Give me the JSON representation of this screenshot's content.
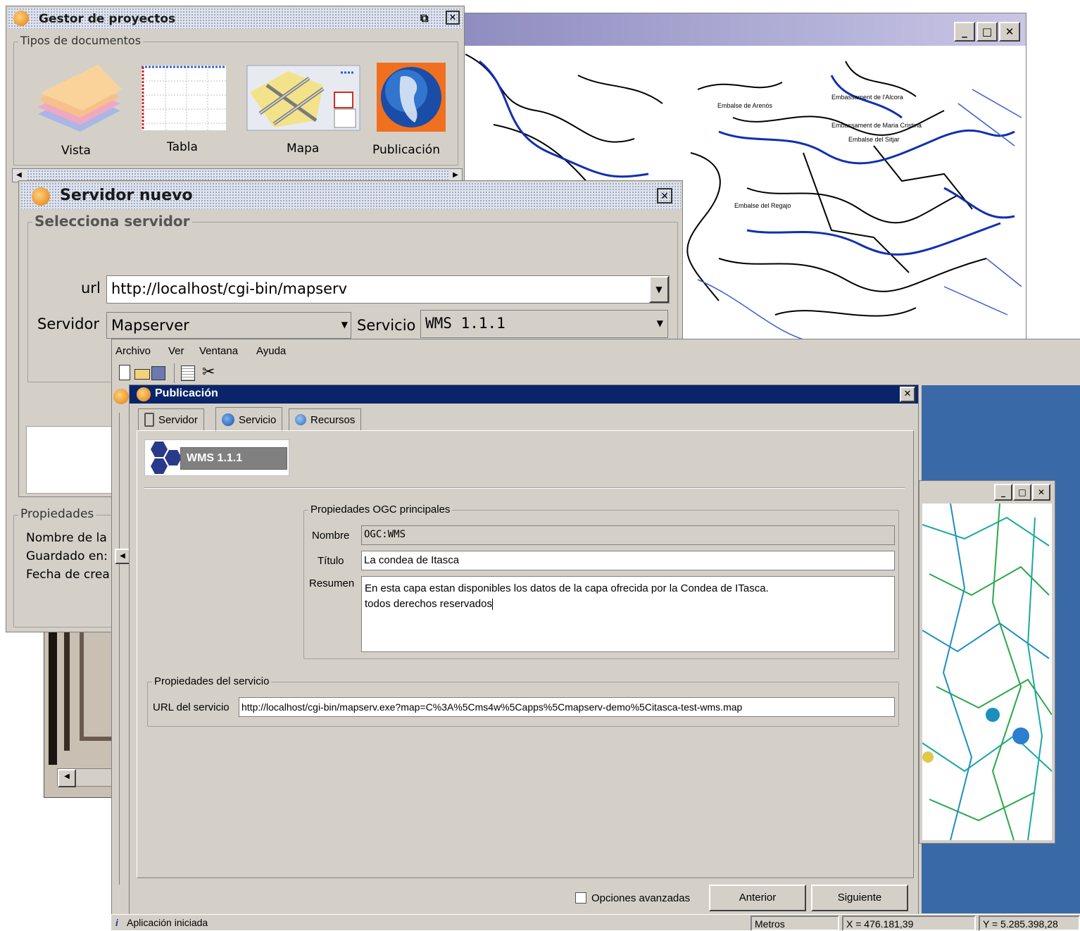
{
  "background_map_window": {
    "labels": [
      "Embalse de Arenós",
      "Embassament de l'Alcora",
      "Embassament de Maria Cristina",
      "Embalse del Sitjar",
      "Embalse del Regajo"
    ]
  },
  "project_manager": {
    "title": "Gestor de proyectos",
    "doc_types_label": "Tipos de documentos",
    "doc_types": [
      {
        "label": "Vista",
        "icon": "vista-layers-icon"
      },
      {
        "label": "Tabla",
        "icon": "table-icon"
      },
      {
        "label": "Mapa",
        "icon": "map-icon"
      },
      {
        "label": "Publicación",
        "icon": "globe-icon"
      }
    ],
    "properties_label": "Propiedades",
    "properties": [
      "Nombre de la",
      "Guardado en:",
      "Fecha de crea"
    ]
  },
  "new_server": {
    "title": "Servidor nuevo",
    "select_server_label": "Selecciona servidor",
    "url_label": "url",
    "url_value": "http://localhost/cgi-bin/mapserv",
    "server_label": "Servidor",
    "server_value": "Mapserver",
    "service_label": "Servicio",
    "service_value": "WMS 1.1.1"
  },
  "main_app": {
    "menu": [
      "Archivo",
      "Ver",
      "Ventana",
      "Ayuda"
    ],
    "status_text": "Aplicación iniciada",
    "units": "Metros",
    "x_coord": "X = 476.181,39",
    "y_coord": "Y = 5.285.398,28"
  },
  "publication": {
    "title": "Publicación",
    "tabs": [
      "Servidor",
      "Servicio",
      "Recursos"
    ],
    "badge": "WMS 1.1.1",
    "ogc_group": "Propiedades OGC principales",
    "name_label": "Nombre",
    "name_value": "OGC:WMS",
    "title_label": "Título",
    "title_value": "La condea de Itasca",
    "abstract_label": "Resumen",
    "abstract_line1": "En esta capa estan disponibles los datos de la capa ofrecida por la Condea de ITasca.",
    "abstract_line2": "todos derechos reservados",
    "service_group": "Propiedades del servicio",
    "service_url_label": "URL del servicio",
    "service_url_value": "http://localhost/cgi-bin/mapserv.exe?map=C%3A%5Cms4w%5Capps%5Cmapserv-demo%5Citasca-test-wms.map",
    "advanced_label": "Opciones avanzadas",
    "prev_button": "Anterior",
    "next_button": "Siguiente"
  },
  "colors": {
    "desktop_blue": "#3a69a8",
    "title_bar_active": "#0a246a",
    "window_face": "#d4d0c8"
  }
}
